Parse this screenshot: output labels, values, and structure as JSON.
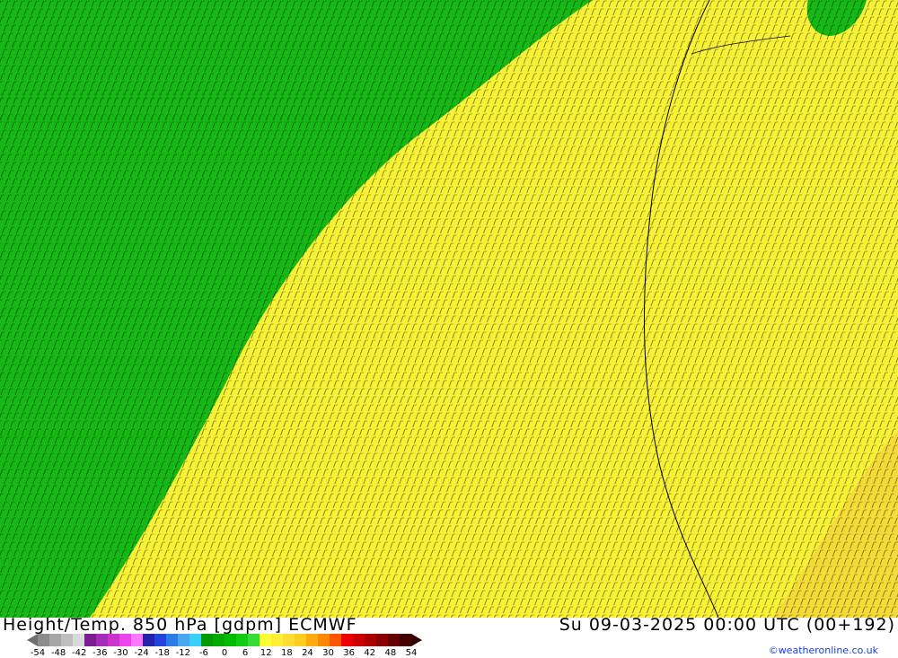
{
  "header": {
    "title": "Height/Temp. 850 hPa [gdpm] ECMWF",
    "datetime": "Su 09-03-2025 00:00 UTC (00+192)"
  },
  "credit": "©weatheronline.co.uk",
  "legend": {
    "labels": [
      "-54",
      "-48",
      "-42",
      "-36",
      "-30",
      "-24",
      "-18",
      "-12",
      "-6",
      "0",
      "6",
      "12",
      "18",
      "24",
      "30",
      "36",
      "42",
      "48",
      "54"
    ],
    "colors": [
      "#8c8c8c",
      "#a6a6a6",
      "#bfbfbf",
      "#d9d9d9",
      "#7a1e8f",
      "#a42bb8",
      "#cc33cc",
      "#ee44ee",
      "#ff77ff",
      "#2222aa",
      "#2244dd",
      "#2a7ae8",
      "#4aa6f0",
      "#38d0f8",
      "#009900",
      "#00aa00",
      "#00bb00",
      "#11cc11",
      "#33dd33",
      "#ffff33",
      "#ffee33",
      "#ffdd33",
      "#ffcc22",
      "#ffaa11",
      "#ff8800",
      "#ff5500",
      "#ee0000",
      "#cc0000",
      "#aa0000",
      "#880000",
      "#660000",
      "#440000"
    ]
  },
  "map": {
    "cold_color": "#16b816",
    "warm_color": "#f7f236",
    "hot_color": "#f4c83a"
  }
}
